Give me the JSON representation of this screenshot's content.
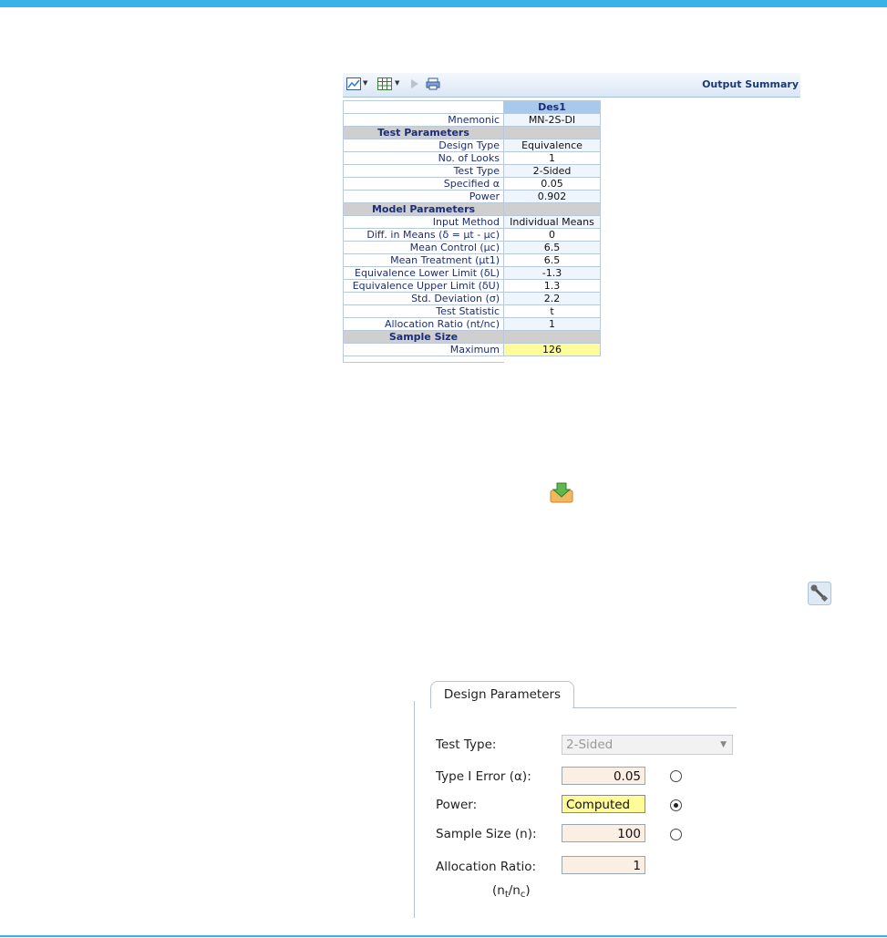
{
  "output_summary": {
    "title": "Output Summary",
    "column_header": "Des1",
    "rows": [
      {
        "type": "row",
        "label": "Mnemonic",
        "value": "MN-2S-DI"
      },
      {
        "type": "section",
        "label": "Test Parameters"
      },
      {
        "type": "row",
        "label": "Design Type",
        "value": "Equivalence"
      },
      {
        "type": "row",
        "label": "No. of Looks",
        "value": "1"
      },
      {
        "type": "row",
        "label": "Test Type",
        "value": "2-Sided"
      },
      {
        "type": "row",
        "label": "Specified α",
        "value": "0.05"
      },
      {
        "type": "row",
        "label": "Power",
        "value": "0.902"
      },
      {
        "type": "section",
        "label": "Model Parameters"
      },
      {
        "type": "row",
        "label": "Input Method",
        "value": "Individual Means"
      },
      {
        "type": "row",
        "label": "Diff. in Means (δ = μt - μc)",
        "value": "0"
      },
      {
        "type": "row",
        "label": "Mean Control (μc)",
        "value": "6.5"
      },
      {
        "type": "row",
        "label": "Mean Treatment (μt1)",
        "value": "6.5"
      },
      {
        "type": "row",
        "label": "Equivalence Lower Limit (δL)",
        "value": "-1.3"
      },
      {
        "type": "row",
        "label": "Equivalence Upper Limit (δU)",
        "value": "1.3"
      },
      {
        "type": "row",
        "label": "Std. Deviation (σ)",
        "value": "2.2"
      },
      {
        "type": "row",
        "label": "Test Statistic",
        "value": "t"
      },
      {
        "type": "row",
        "label": "Allocation Ratio (nt/nc)",
        "value": "1"
      },
      {
        "type": "section",
        "label": "Sample Size"
      },
      {
        "type": "row",
        "label": "Maximum",
        "value": "126",
        "highlight": true
      }
    ]
  },
  "design_parameters": {
    "tab_label": "Design Parameters",
    "test_type_label": "Test Type:",
    "test_type_value": "2-Sided",
    "type1_label": "Type I Error (α):",
    "type1_value": "0.05",
    "power_label": "Power:",
    "power_value": "Computed",
    "sample_size_label": "Sample Size (n):",
    "sample_size_value": "100",
    "alloc_label": "Allocation Ratio:",
    "alloc_value": "1",
    "alloc_sub_open": "(n",
    "alloc_sub_t": "t",
    "alloc_sub_mid": "/n",
    "alloc_sub_c": "c",
    "alloc_sub_close": ")",
    "selected_radio": "power"
  },
  "colors": {
    "accent": "#3ab1e8",
    "computed_highlight": "#fdfc98",
    "input_bg": "#fbeee2"
  }
}
